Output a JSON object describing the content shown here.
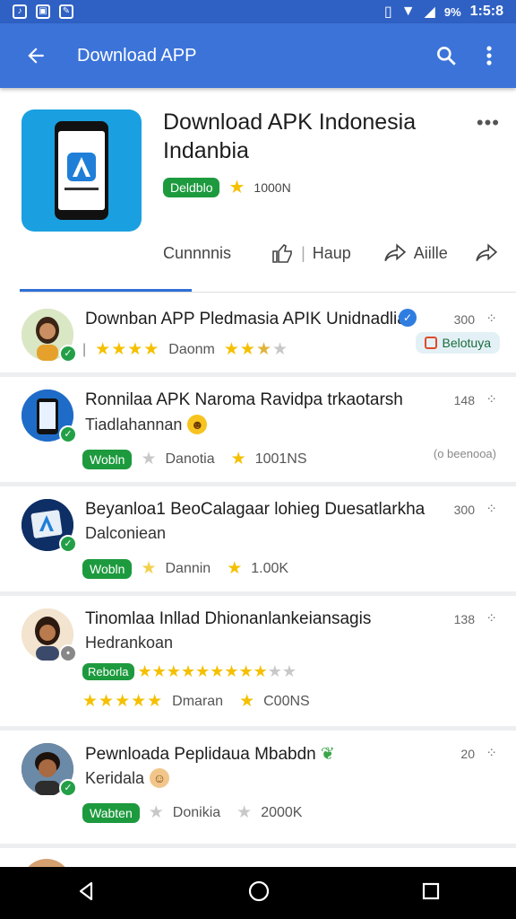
{
  "status_bar": {
    "battery": "9%",
    "time": "1:5:8"
  },
  "app_bar": {
    "title": "Download APP"
  },
  "header": {
    "title_line1": "Download APK Indonesia",
    "title_line2": "Indanbia",
    "badge": "Deldblo",
    "rating": "1000N",
    "actions": [
      {
        "label": "Cunnnnis"
      },
      {
        "label": "Haup"
      },
      {
        "label": "Aiille"
      }
    ]
  },
  "rows": [
    {
      "title": "Downban APP Pledmasia APIK Unidnadlia",
      "count": "300",
      "meta_left": "Daonm",
      "chip": "Belotuya"
    },
    {
      "title": "Ronnilaa APK Naroma Ravidpa trkaotarsh",
      "subtitle": "Tiadlahannan",
      "count": "148",
      "badge": "Wobln",
      "meta_left": "Danotia",
      "meta_right": "1001NS",
      "side_text": "(o beenooa)"
    },
    {
      "title": "Beyanloa1 BeoCalagaar lohieg Duesatlarkha",
      "subtitle": "Dalconiean",
      "count": "300",
      "badge": "Wobln",
      "meta_left": "Dannin",
      "meta_right": "1.00K"
    },
    {
      "title": "Tinomlaa Inllad Dhionanlankeiansagis",
      "subtitle": "Hedrankoan",
      "count": "138",
      "badge": "Reborla",
      "meta_left": "Dmaran",
      "meta_right": "C00NS"
    },
    {
      "title": "Pewnloada Peplidaua Mbabdn",
      "subtitle": "Keridala",
      "count": "20",
      "badge": "Wabten",
      "meta_left": "Donikia",
      "meta_right": "2000K"
    }
  ],
  "colors": {
    "app_bar": "#3b73d9",
    "status_bar": "#2f61c4",
    "green_badge": "#1d9a3e",
    "star": "#f5c000",
    "app_icon_bg": "#1aa0e0"
  }
}
